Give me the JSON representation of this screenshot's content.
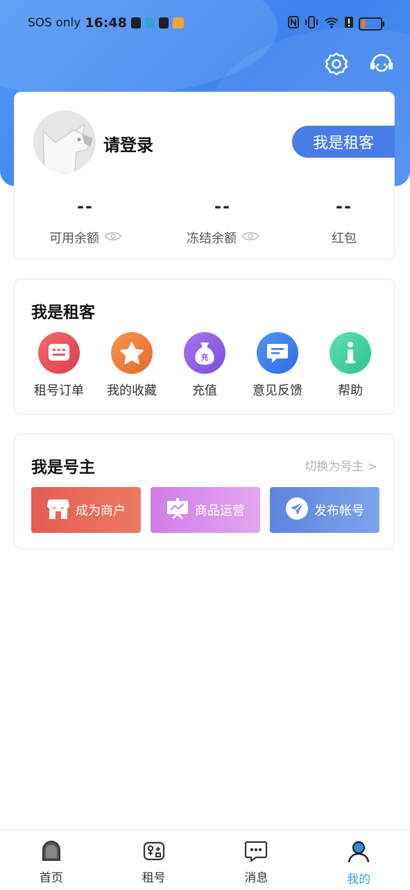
{
  "status_bar": {
    "carrier": "SOS only",
    "time": "16:48"
  },
  "header": {
    "settings_icon": "gear-icon",
    "service_icon": "customer-service-icon"
  },
  "user_card": {
    "login_prompt": "请登录",
    "role_button": "我是租客",
    "balances": [
      {
        "value": "--",
        "label": "可用余额"
      },
      {
        "value": "--",
        "label": "冻结余额"
      },
      {
        "value": "--",
        "label": "红包"
      }
    ]
  },
  "tenant_section": {
    "title": "我是租客",
    "items": [
      {
        "label": "租号订单",
        "icon": "order-icon",
        "color": "#e8535a"
      },
      {
        "label": "我的收藏",
        "icon": "star-icon",
        "color": "#f07e3c"
      },
      {
        "label": "充值",
        "icon": "money-bag-icon",
        "color": "#8f5ce6"
      },
      {
        "label": "意见反馈",
        "icon": "feedback-icon",
        "color": "#3d7ef0"
      },
      {
        "label": "帮助",
        "icon": "info-icon",
        "color": "#3fcf9e"
      }
    ]
  },
  "owner_section": {
    "title": "我是号主",
    "switch_link": "切换为号主 >",
    "buttons": [
      {
        "label": "成为商户",
        "icon": "shop-icon",
        "color": "#e8635a"
      },
      {
        "label": "商品运营",
        "icon": "presentation-icon",
        "color": "#d78be6"
      },
      {
        "label": "发布帐号",
        "icon": "send-icon",
        "color": "#6b8fe0"
      }
    ]
  },
  "tab_bar": {
    "tabs": [
      {
        "label": "首页",
        "icon": "home-icon"
      },
      {
        "label": "租号",
        "icon": "gamepad-icon"
      },
      {
        "label": "消息",
        "icon": "message-icon"
      },
      {
        "label": "我的",
        "icon": "profile-icon"
      }
    ],
    "active_color": "#3aa0dc"
  }
}
